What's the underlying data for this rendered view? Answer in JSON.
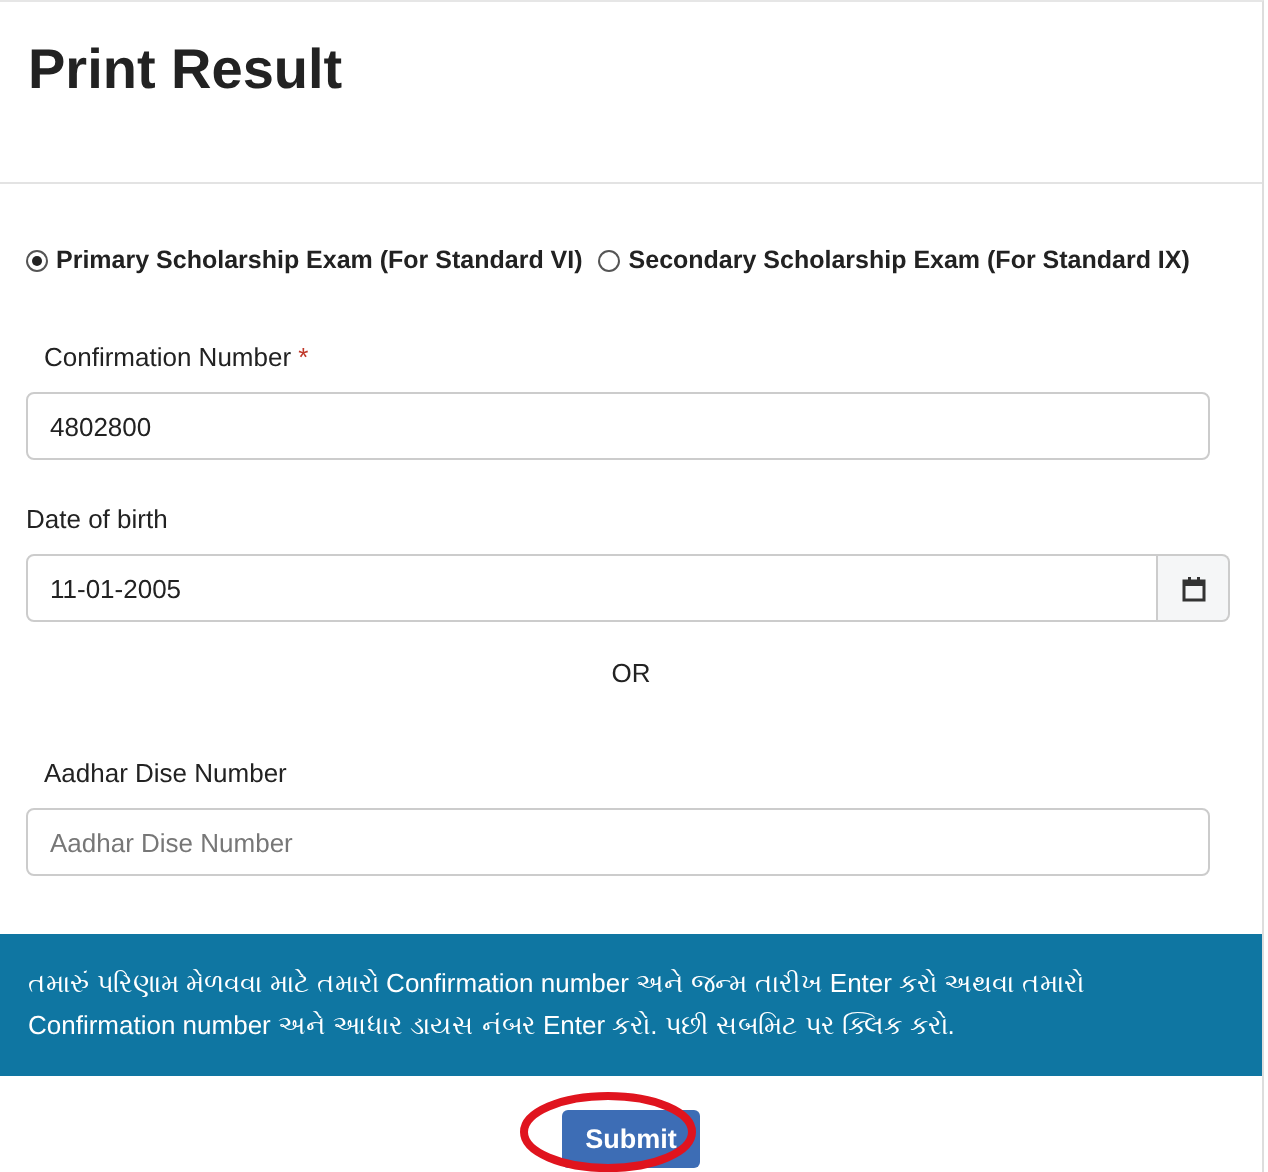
{
  "title": "Print Result",
  "exam_options": [
    {
      "label": "Primary Scholarship Exam (For Standard VI)",
      "selected": true
    },
    {
      "label": "Secondary Scholarship Exam (For Standard IX)",
      "selected": false
    }
  ],
  "confirmation": {
    "label": "Confirmation Number",
    "required_mark": "*",
    "value": "4802800"
  },
  "dob": {
    "label": "Date of birth",
    "value": "11-01-2005"
  },
  "or_text": "OR",
  "aadhar": {
    "label": "Aadhar Dise Number",
    "placeholder": "Aadhar Dise Number"
  },
  "notice": "તમારું પરિણામ મેળવવા માટે તમારો Confirmation number અને જન્મ તારીખ Enter કરો અથવા તમારો Confirmation number અને આધાર ડાયસ નંબર Enter કરો. પછી સબમિટ પર ક્લિક કરો.",
  "submit": {
    "label": "Submit",
    "circled": true
  }
}
